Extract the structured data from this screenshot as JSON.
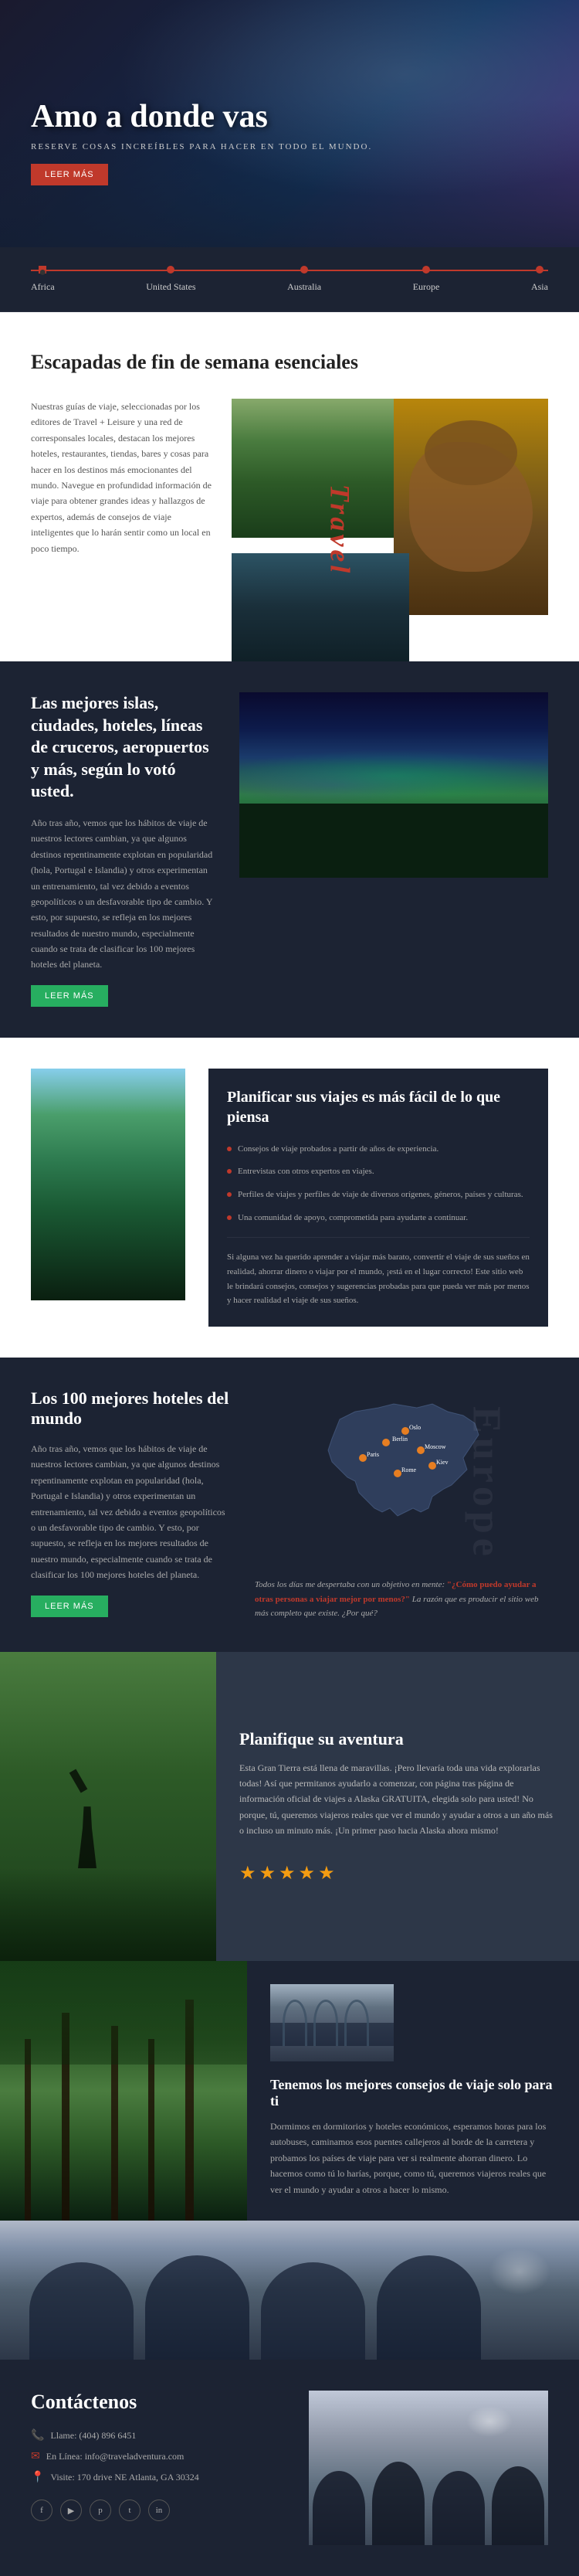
{
  "hero": {
    "title": "Amo a donde vas",
    "subtitle": "RESERVE COSAS INCREÍBLES PARA HACER EN TODO EL MUNDO.",
    "cta": "Leer más"
  },
  "nav": {
    "tabs": [
      "Africa",
      "United States",
      "Australia",
      "Europe",
      "Asia"
    ]
  },
  "escapadas": {
    "heading": "Escapadas de fin de semana esenciales",
    "text": "Nuestras guías de viaje, seleccionadas por los editores de Travel + Leisure y una red de corresponsales locales, destacan los mejores hoteles, restaurantes, tiendas, bares y cosas para hacer en los destinos más emocionantes del mundo. Navegue en profundidad información de viaje para obtener grandes ideas y hallazgos de expertos, además de consejos de viaje inteligentes que lo harán sentir como un local en poco tiempo.",
    "vertical_label": "Travel"
  },
  "islands": {
    "heading": "Las mejores islas, ciudades, hoteles, líneas de cruceros, aeropuertos y más, según lo votó usted.",
    "text": "Año tras año, vemos que los hábitos de viaje de nuestros lectores cambian, ya que algunos destinos repentinamente explotan en popularidad (hola, Portugal e Islandia) y otros experimentan un entrenamiento, tal vez debido a eventos geopolíticos o un desfavorable tipo de cambio. Y esto, por supuesto, se refleja en los mejores resultados de nuestro mundo, especialmente cuando se trata de clasificar los 100 mejores hoteles del planeta.",
    "cta": "Leer más"
  },
  "plan": {
    "heading": "Planificar sus viajes es más fácil de lo que piensa",
    "bullets": [
      "Consejos de viaje probados a partir de años de experiencia.",
      "Entrevistas con otros expertos en viajes.",
      "Perfiles de viajes y perfiles de viaje de diversos orígenes, géneros, países y culturas.",
      "Una comunidad de apoyo, comprometida para ayudarte a continuar."
    ],
    "body": "Si alguna vez ha querido aprender a viajar más barato, convertir el viaje de sus sueños en realidad, ahorrar dinero o viajar por el mundo, ¡está en el lugar correcto! Este sitio web le brindará consejos, consejos y sugerencias probadas para que pueda ver más por menos y hacer realidad el viaje de sus sueños."
  },
  "hotels": {
    "heading": "Los 100 mejores hoteles del mundo",
    "text": "Año tras año, vemos que los hábitos de viaje de nuestros lectores cambian, ya que algunos destinos repentinamente explotan en popularidad (hola, Portugal e Islandia) y otros experimentan un entrenamiento, tal vez debido a eventos geopolíticos o un desfavorable tipo de cambio. Y esto, por supuesto, se refleja en los mejores resultados de nuestro mundo, especialmente cuando se trata de clasificar los 100 mejores hoteles del planeta.",
    "cta": "Leer más",
    "europe_label": "Europe",
    "quote": "Todos los días me despertaba con un objetivo en mente: \"¿Cómo puedo ayudar a otras personas a viajar mejor por menos?\" La razón que es producir el sitio web más completo que existe. ¿Por qué?"
  },
  "adventure": {
    "heading": "Planifique su aventura",
    "text": "Esta Gran Tierra está llena de maravillas. ¡Pero llevaría toda una vida explorarlas todas! Así que permitanos ayudarlo a comenzar, con página tras página de información oficial de viajes a Alaska GRATUITA, elegida solo para usted! No porque, tú, queremos viajeros reales que ver el mundo y ayudar a otros a un año más o incluso un minuto más. ¡Un primer paso hacia Alaska ahora mismo!",
    "stars": "★★★★★",
    "lower_heading": "Tenemos los mejores consejos de viaje solo para ti",
    "lower_text": "Dormimos en dormitorios y hoteles económicos, esperamos horas para los autobuses, caminamos esos puentes callejeros al borde de la carretera y probamos los países de viaje para ver si realmente ahorran dinero. Lo hacemos como tú lo harías, porque, como tú, queremos viajeros reales que ver el mundo y ayudar a otros a hacer lo mismo."
  },
  "contact": {
    "heading": "Contáctenos",
    "phone_label": "Llame: (404) 896 6451",
    "email_label": "En Línea: info@traveladventura.com",
    "address_label": "Visite: 170 drive NE Atlanta, GA 30324",
    "socials": [
      "f",
      "y",
      "p",
      "t",
      "in"
    ]
  }
}
